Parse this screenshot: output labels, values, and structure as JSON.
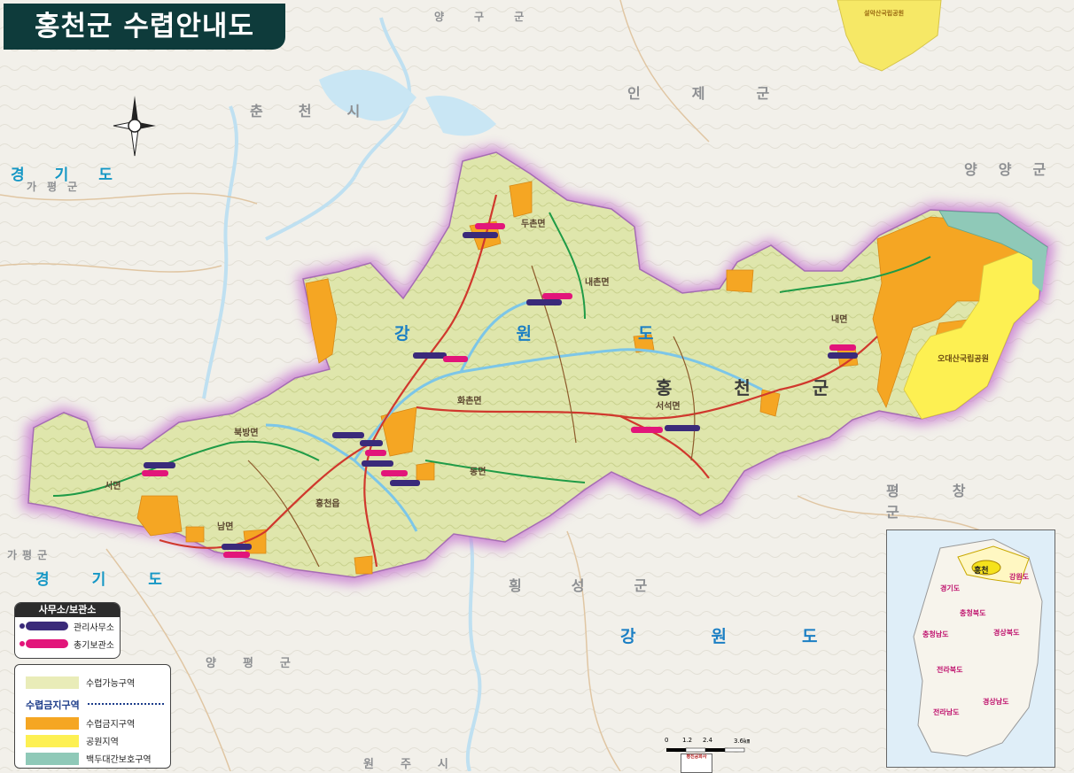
{
  "title": "홍천군  수렵안내도",
  "regions": {
    "gyeonggi_nw": "경기도",
    "gapyeong_nw": "가평군",
    "chuncheon": "춘천시",
    "yanggu": "양구군",
    "inje": "인제군",
    "yangyang": "양양군",
    "pyeongchang": "평창군",
    "hoengseong": "횡성군",
    "gangwon_south": "강원도",
    "gyeonggi_sw": "경기도",
    "gapyeong_sw": "가평군",
    "yangpyeong": "양평군",
    "wonju": "원주시",
    "gangwon_main": "강원도",
    "hongcheon_main": "홍천군",
    "odaesan": "오대산국립공원",
    "seorak": "설악산국립공원"
  },
  "towns": [
    "두촌면",
    "내촌면",
    "화촌면",
    "서석면",
    "내면",
    "북방면",
    "서면",
    "남면",
    "동면",
    "홍천읍"
  ],
  "legend_offices": {
    "header": "사무소/보관소",
    "items": [
      {
        "label": "관리사무소",
        "color": "#3a2a7a"
      },
      {
        "label": "총기보관소",
        "color": "#e2157a"
      }
    ]
  },
  "legend_zones": {
    "allowed": {
      "label": "수렵가능구역",
      "color": "#e9ecb8"
    },
    "forbidden_header": "수렵금지구역",
    "items": [
      {
        "label": "수렵금지구역",
        "color": "#f5a623"
      },
      {
        "label": "공원지역",
        "color": "#fdf052"
      },
      {
        "label": "백두대간보호구역",
        "color": "#8fc9b8"
      }
    ]
  },
  "inset": {
    "highlight": "홍천",
    "province": "강원도",
    "gyeonggi": "경기도",
    "chungbuk": "충청북도",
    "chungnam": "충청남도",
    "gyeongbuk": "경상북도",
    "jeonbuk": "전라북도",
    "gyeongnam": "경상남도",
    "jeonnam": "전라남도"
  },
  "scale": {
    "labels": [
      "0",
      "1.2",
      "2.4",
      "3.6㎞"
    ]
  },
  "publisher": {
    "name": "평진공화사"
  },
  "colors": {
    "title_bg": "#0e3b3b",
    "county_fill": "#dbe3a6",
    "halo": "#c77fcf",
    "forbidden": "#f5a623",
    "park": "#fdf052",
    "baekdu": "#8fc9b8"
  }
}
